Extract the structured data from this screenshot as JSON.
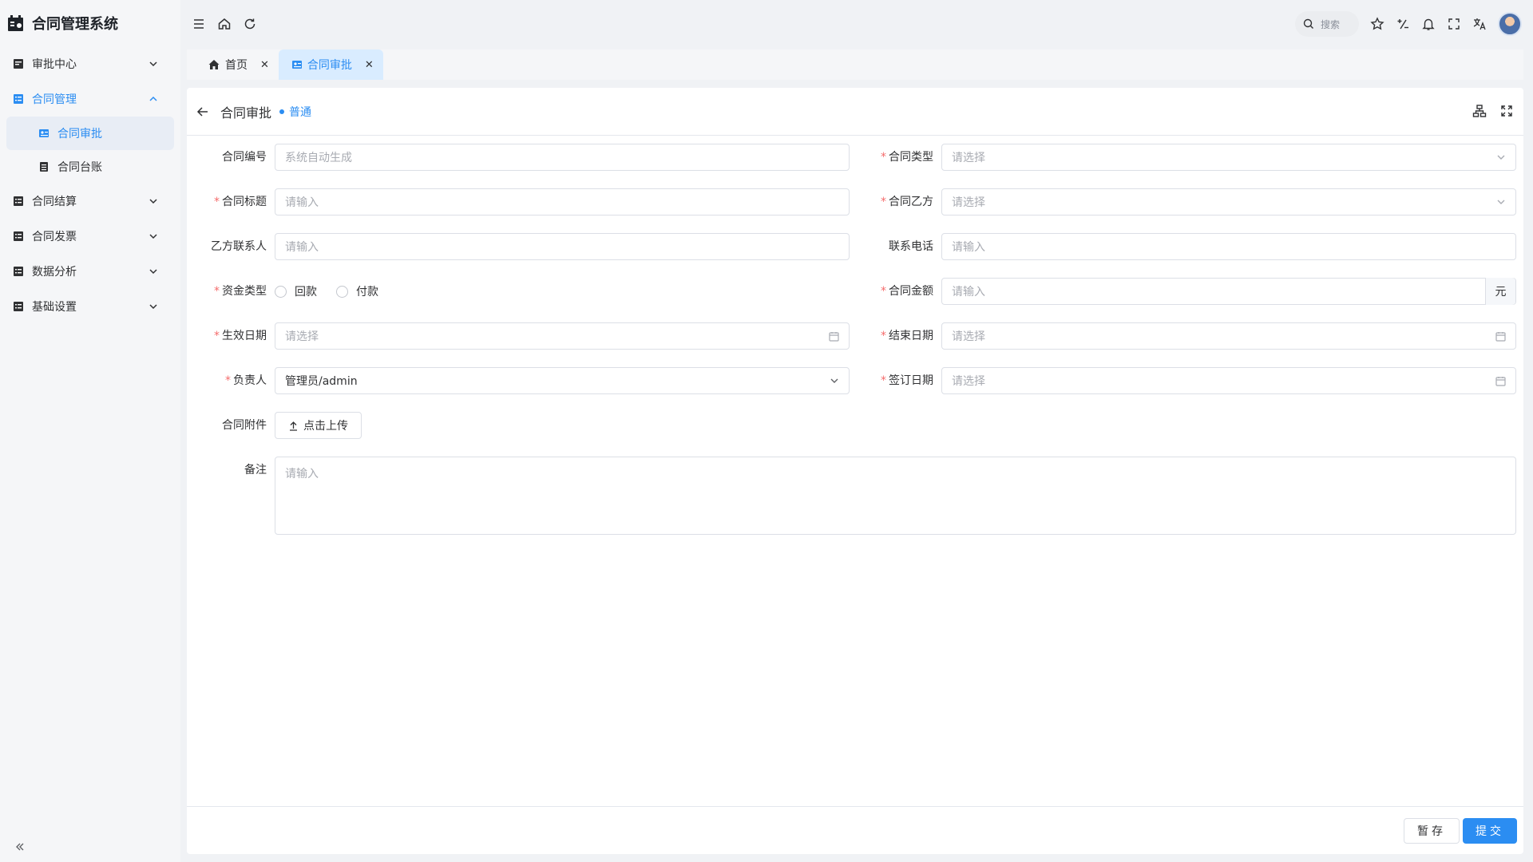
{
  "app": {
    "title": "合同管理系统"
  },
  "sidebar": {
    "items": [
      {
        "label": "审批中心"
      },
      {
        "label": "合同管理",
        "children": [
          {
            "label": "合同审批",
            "active": true
          },
          {
            "label": "合同台账"
          }
        ]
      },
      {
        "label": "合同结算"
      },
      {
        "label": "合同发票"
      },
      {
        "label": "数据分析"
      },
      {
        "label": "基础设置"
      }
    ]
  },
  "header": {
    "search_placeholder": "搜索"
  },
  "tabs": [
    {
      "label": "首页"
    },
    {
      "label": "合同审批",
      "active": true
    }
  ],
  "page": {
    "title": "合同审批",
    "badge": "普通"
  },
  "form": {
    "contract_no": {
      "label": "合同编号",
      "placeholder": "系统自动生成"
    },
    "contract_type": {
      "label": "合同类型",
      "placeholder": "请选择",
      "required": true
    },
    "contract_title": {
      "label": "合同标题",
      "placeholder": "请输入",
      "required": true
    },
    "party_b": {
      "label": "合同乙方",
      "placeholder": "请选择",
      "required": true
    },
    "party_b_contact": {
      "label": "乙方联系人",
      "placeholder": "请输入"
    },
    "phone": {
      "label": "联系电话",
      "placeholder": "请输入"
    },
    "fund_type": {
      "label": "资金类型",
      "required": true,
      "options": [
        "回款",
        "付款"
      ]
    },
    "amount": {
      "label": "合同金额",
      "placeholder": "请输入",
      "unit": "元",
      "required": true
    },
    "effective_date": {
      "label": "生效日期",
      "placeholder": "请选择",
      "required": true
    },
    "end_date": {
      "label": "结束日期",
      "placeholder": "请选择",
      "required": true
    },
    "owner": {
      "label": "负责人",
      "value": "管理员/admin",
      "required": true
    },
    "sign_date": {
      "label": "签订日期",
      "placeholder": "请选择",
      "required": true
    },
    "attachment": {
      "label": "合同附件",
      "button": "点击上传"
    },
    "remark": {
      "label": "备注",
      "placeholder": "请输入"
    }
  },
  "footer": {
    "draft": "暂存",
    "submit": "提交"
  },
  "colors": {
    "primary": "#2b8df2",
    "danger": "#f56c6c",
    "sidebar_bg": "#f5f6f8"
  }
}
